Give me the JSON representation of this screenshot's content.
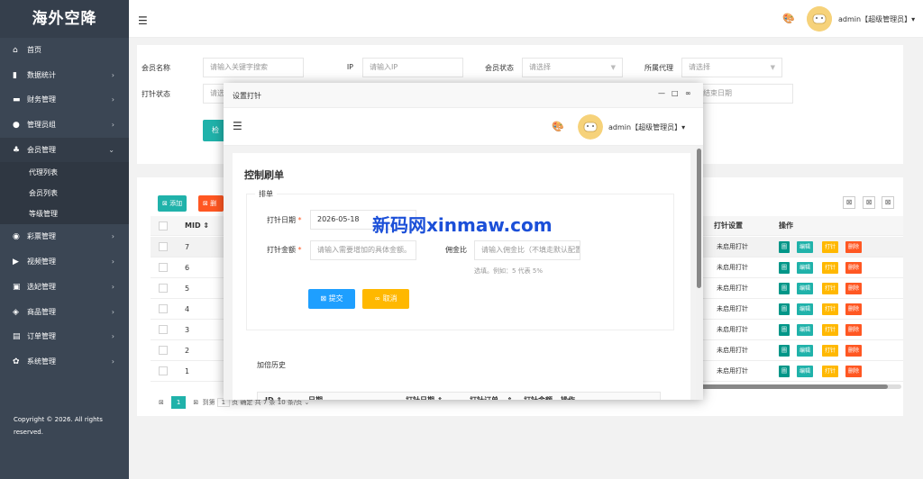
{
  "brand": "海外空降",
  "sidebar": {
    "items": [
      {
        "icon": "⌂",
        "label": "首页",
        "arrow": ""
      },
      {
        "icon": "▮",
        "label": "数据统计",
        "arrow": "›"
      },
      {
        "icon": "▬",
        "label": "财务管理",
        "arrow": "›"
      },
      {
        "icon": "●",
        "label": "管理员组",
        "arrow": "›"
      },
      {
        "icon": "♣",
        "label": "会员管理",
        "arrow": "⌄"
      }
    ],
    "sub_items": [
      "代理列表",
      "会员列表",
      "等级管理"
    ],
    "items2": [
      {
        "icon": "◉",
        "label": "彩票管理",
        "arrow": "›"
      },
      {
        "icon": "▶",
        "label": "视频管理",
        "arrow": "›"
      },
      {
        "icon": "▣",
        "label": "选妃管理",
        "arrow": "›"
      },
      {
        "icon": "◈",
        "label": "商品管理",
        "arrow": "›"
      },
      {
        "icon": "▤",
        "label": "订单管理",
        "arrow": "›"
      },
      {
        "icon": "✿",
        "label": "系统管理",
        "arrow": "›"
      }
    ],
    "copyright_line1": "Copyright © 2026. All rights",
    "copyright_line2": "reserved."
  },
  "header": {
    "menu_icon": "☰",
    "palette_icon": "🎨",
    "user": "admin【超级管理员】▾"
  },
  "filters": {
    "member_name_label": "会员名称",
    "member_name_placeholder": "请输入关键字搜索",
    "ip_label": "IP",
    "ip_placeholder": "请输入IP",
    "status_label": "会员状态",
    "status_value": "请选择",
    "agent_label": "所属代理",
    "agent_value": "请选择",
    "punch_status_label": "打针状态",
    "punch_status_value": "请选",
    "end_date_placeholder": "结束日期",
    "search_button": "检"
  },
  "table": {
    "add_button": "添加",
    "delete_button": "删",
    "tool_icons": [
      "⊠",
      "⊠",
      "⊠"
    ],
    "columns": {
      "mid": "MID ⇕",
      "punch_setting": "打针设置",
      "action": "操作"
    },
    "rows": [
      {
        "mid": "7",
        "status": "未启用打针"
      },
      {
        "mid": "6",
        "status": "未启用打针"
      },
      {
        "mid": "5",
        "status": "未启用打针"
      },
      {
        "mid": "4",
        "status": "未启用打针"
      },
      {
        "mid": "3",
        "status": "未启用打针"
      },
      {
        "mid": "2",
        "status": "未启用打针"
      },
      {
        "mid": "1",
        "status": "未启用打针"
      }
    ],
    "actions": [
      "圖",
      "编辑",
      "打针",
      "删除"
    ],
    "pager": {
      "current": "1",
      "goto": "到第",
      "page_input": "1",
      "page_unit": "页",
      "confirm": "确定",
      "total": "共 7 条",
      "per_page": "10 条/页 ⌄"
    }
  },
  "modal": {
    "title": "设置打针",
    "controls": [
      "—",
      "□",
      "∞"
    ],
    "inner_user": "admin【超级管理员】▾",
    "card_title": "控制刷单",
    "section_title": "排单",
    "date_label": "打针日期",
    "date_value": "2026-05-18",
    "amount_label": "打针金额",
    "amount_placeholder": "请输入需要增加的具体金额。",
    "ratio_label": "佣金比",
    "ratio_placeholder": "请输入佣金比（不填走默认配置）",
    "ratio_hint": "选填。例如：5 代表 5%",
    "submit_button": "提交",
    "cancel_button": "取消",
    "history_title": "加倍历史",
    "history_columns": [
      "ID ⇕",
      "日期",
      "打针日期 ⇕",
      "打针订单...⇕",
      "打针金额",
      "操作"
    ]
  },
  "watermark": "新码网xinmaw.com"
}
